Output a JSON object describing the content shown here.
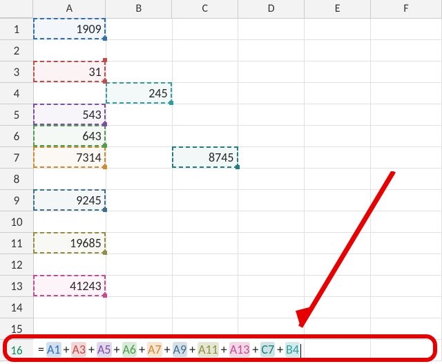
{
  "columns": [
    "A",
    "B",
    "C",
    "D",
    "E",
    "F"
  ],
  "row_headers": [
    "1",
    "2",
    "3",
    "4",
    "5",
    "6",
    "7",
    "8",
    "9",
    "10",
    "11",
    "12",
    "13",
    "14",
    "15",
    "16"
  ],
  "active_row": "16",
  "cells": {
    "A1": "1909",
    "A3": "31",
    "B4": "245",
    "A5": "543",
    "A6": "643",
    "A7": "7314",
    "C7": "8745",
    "A9": "9245",
    "A11": "19685",
    "A13": "41243"
  },
  "formula": {
    "prefix": "=",
    "tokens": [
      {
        "ref": "A1",
        "cls": "t-blue"
      },
      {
        "ref": "A3",
        "cls": "t-red"
      },
      {
        "ref": "A5",
        "cls": "t-purple"
      },
      {
        "ref": "A6",
        "cls": "t-green"
      },
      {
        "ref": "A7",
        "cls": "t-orange"
      },
      {
        "ref": "A9",
        "cls": "t-slate"
      },
      {
        "ref": "A11",
        "cls": "t-olive"
      },
      {
        "ref": "A13",
        "cls": "t-pink"
      },
      {
        "ref": "C7",
        "cls": "t-dteal"
      },
      {
        "ref": "B4",
        "cls": "t-teal"
      }
    ],
    "operator": "+"
  },
  "ref_highlights": [
    {
      "ref": "A1",
      "cls": "ref-blue",
      "handle": "h-blue"
    },
    {
      "ref": "A2",
      "cls": "ref-red",
      "handle": "h-red",
      "empty": true,
      "note": "handle-only hint near A3"
    },
    {
      "ref": "A3",
      "cls": "ref-red",
      "handle": "h-red"
    },
    {
      "ref": "B4",
      "cls": "ref-teal",
      "handle": "h-teal"
    },
    {
      "ref": "A5",
      "cls": "ref-purple",
      "handle": "h-purple"
    },
    {
      "ref": "A6",
      "cls": "ref-green",
      "handle": "h-green"
    },
    {
      "ref": "A7",
      "cls": "ref-orange",
      "handle": "h-orange"
    },
    {
      "ref": "C7",
      "cls": "ref-dteal",
      "handle": "h-dteal"
    },
    {
      "ref": "A9",
      "cls": "ref-slate",
      "handle": "h-slate"
    },
    {
      "ref": "A11",
      "cls": "ref-olive",
      "handle": "h-olive"
    },
    {
      "ref": "A13",
      "cls": "ref-pink",
      "handle": "h-pink"
    }
  ]
}
